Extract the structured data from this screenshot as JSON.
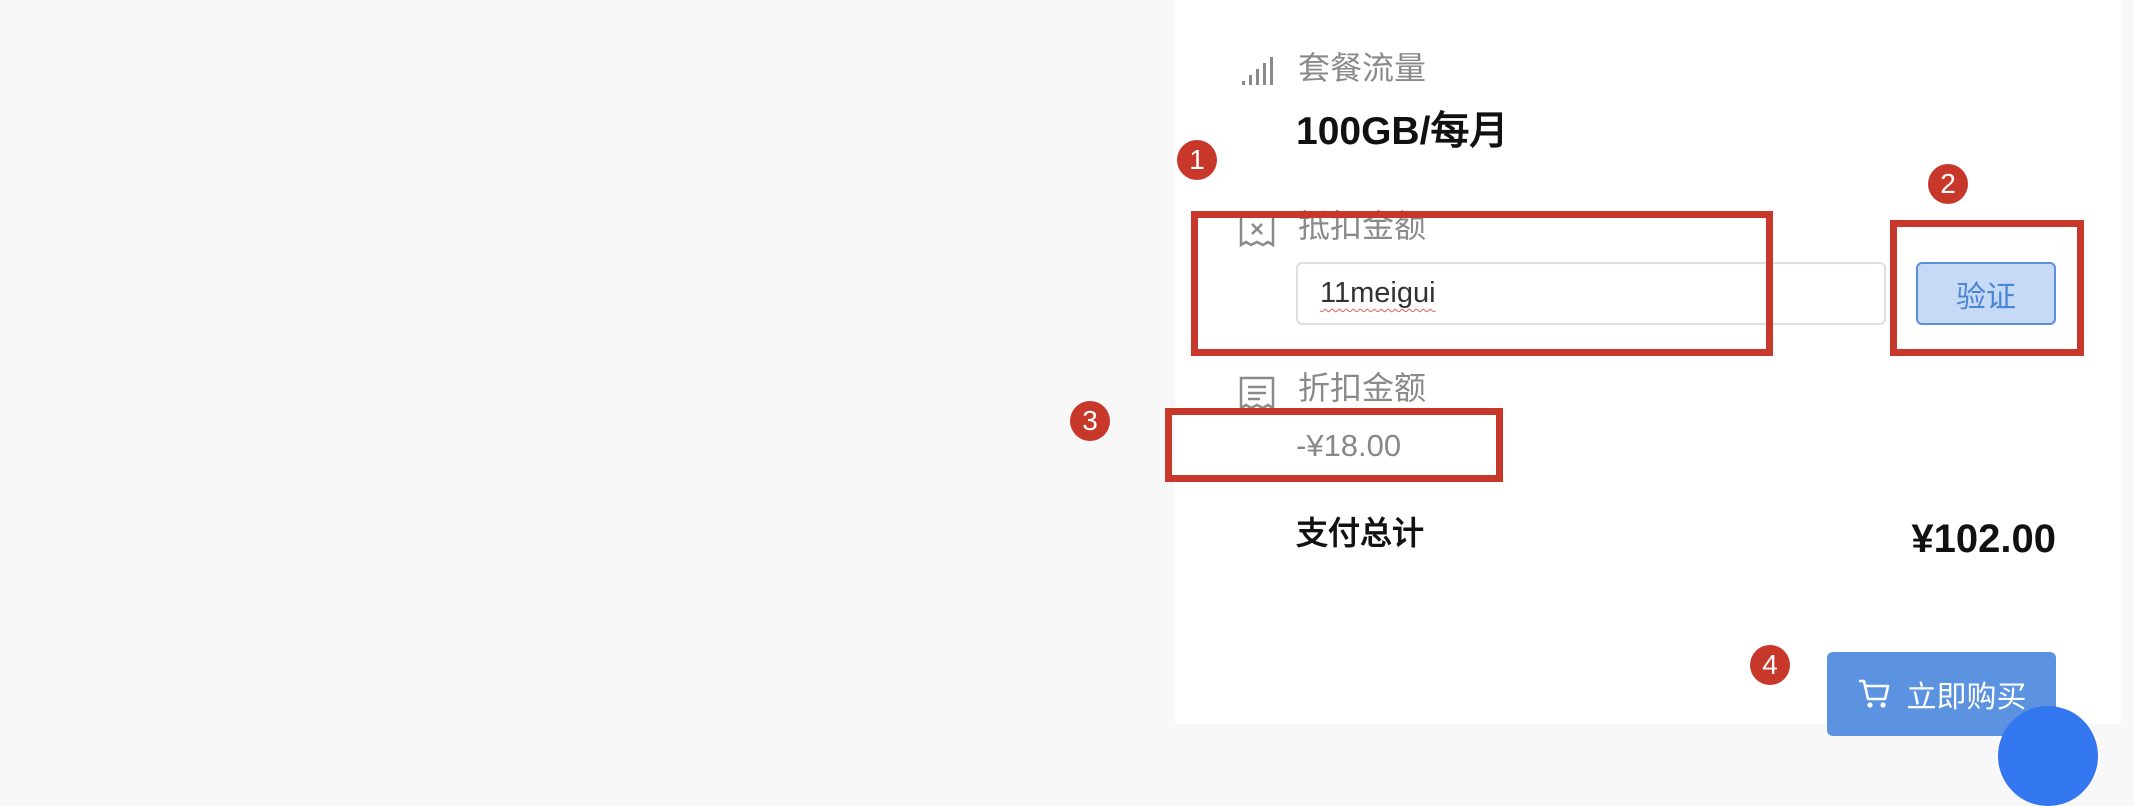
{
  "plan": {
    "traffic_label": "套餐流量",
    "traffic_value": "100GB/每月"
  },
  "deduction": {
    "label": "抵扣金额",
    "input_value": "11meigui",
    "verify_label": "验证"
  },
  "discount": {
    "label": "折扣金额",
    "value": "-¥18.00"
  },
  "total": {
    "label": "支付总计",
    "value": "¥102.00"
  },
  "buy": {
    "label": "立即购买"
  },
  "annotations": [
    "1",
    "2",
    "3",
    "4"
  ],
  "colors": {
    "annotation_red": "#c8382a",
    "primary_blue": "#5b93e0",
    "verify_bg": "#c6d9f5",
    "fab_blue": "#3377f0"
  },
  "icons": {
    "traffic": "signal-bars-icon",
    "deduction": "receipt-x-icon",
    "discount": "receipt-icon",
    "buy": "cart-icon"
  }
}
